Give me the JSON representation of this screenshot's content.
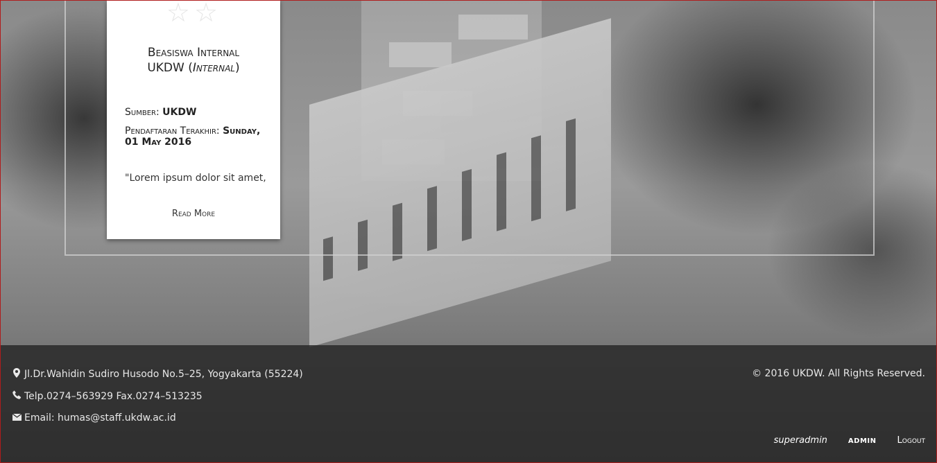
{
  "card": {
    "stars_glyph": "☆☆",
    "title_line1": "Beasiswa Internal",
    "title_line2_prefix": "UKDW (",
    "title_line2_em": "Internal",
    "title_line2_suffix": ")",
    "source_label": "Sumber: ",
    "source_value": "UKDW",
    "deadline_label": "Pendaftaran Terakhir: ",
    "deadline_value": "Sunday, 01 May 2016",
    "excerpt": "\"Lorem ipsum dolor sit amet,",
    "read_more": "Read More"
  },
  "footer": {
    "address": "Jl.Dr.Wahidin Sudiro Husodo No.5–25, Yogyakarta (55224)",
    "phone": "Telp.0274–563929 Fax.0274–513235",
    "email": "Email: humas@staff.ukdw.ac.id",
    "copyright": "© 2016 UKDW. All Rights Reserved.",
    "username": "superadmin",
    "role": "ADMIN",
    "logout": "Logout"
  },
  "icons": {
    "location": "map-marker-icon",
    "phone": "phone-icon",
    "email": "envelope-icon",
    "stars": "star-outline-icon"
  },
  "colors": {
    "window_border": "#b01c1c",
    "footer_bg": "#262626",
    "card_bg": "#ffffff"
  }
}
